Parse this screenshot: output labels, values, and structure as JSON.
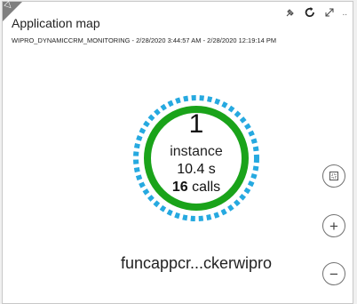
{
  "tile": {
    "title": "Application map",
    "subtitle": "WIPRO_DYNAMICCRM_MONITORING - 2/28/2020 3:44:57 AM - 2/28/2020 12:19:14 PM",
    "toolbar": {
      "pin_icon": "pin-icon",
      "refresh_icon": "refresh-icon",
      "expand_icon": "expand-icon",
      "more_label": ".."
    }
  },
  "node": {
    "count": "1",
    "unit": "instance",
    "duration": "10.4 s",
    "calls_count": "16",
    "calls_label": " calls",
    "name": "funcappcr...ckerwipro",
    "ring_color": "#1aa31a",
    "dash_color": "#26a9e0"
  },
  "controls": {
    "fit": "fit-to-screen-icon",
    "zoom_in": "+",
    "zoom_out": "−"
  }
}
